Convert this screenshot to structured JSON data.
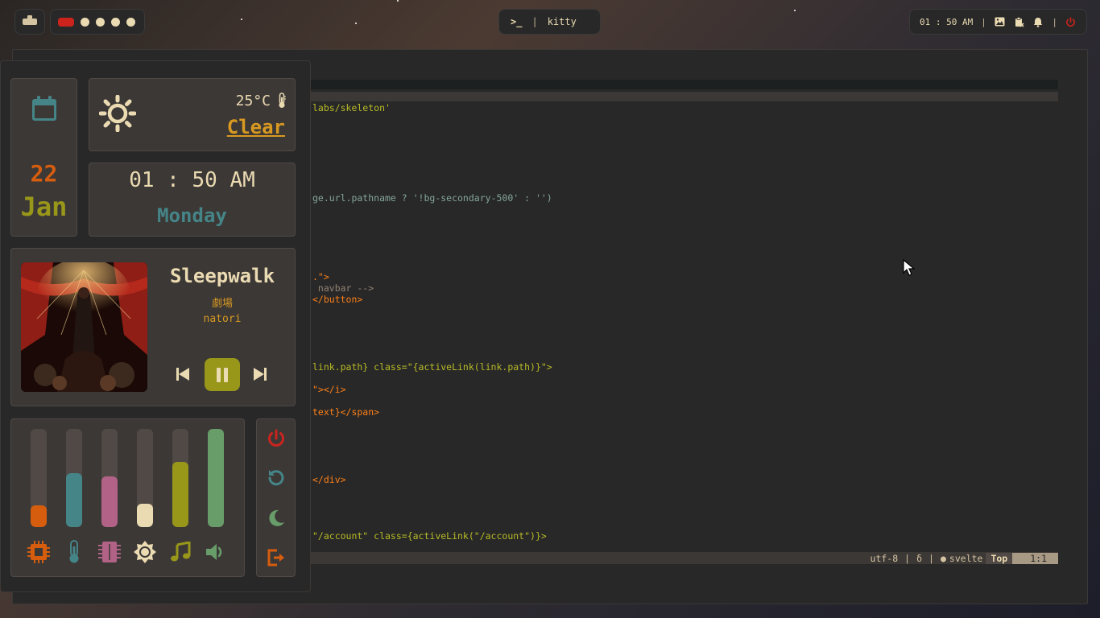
{
  "topbar": {
    "launcher_icon": "launcher-icon",
    "workspaces": [
      {
        "name": "workspace-1",
        "active": true
      },
      {
        "name": "workspace-2",
        "active": false
      },
      {
        "name": "workspace-3",
        "active": false
      },
      {
        "name": "workspace-4",
        "active": false
      },
      {
        "name": "workspace-5",
        "active": false
      }
    ],
    "window": {
      "icon": "terminal-icon",
      "prompt": ">_",
      "sep": "|",
      "title": "kitty"
    },
    "tray": {
      "time": "01 : 50 AM",
      "sep": "|",
      "icons": [
        "screenshot-icon",
        "clipboard-icon",
        "bell-icon",
        "power-icon"
      ]
    }
  },
  "editor": {
    "lines": [
      {
        "row": "l1",
        "text": "labs/skeleton'"
      },
      {
        "row": "l2",
        "text": "ge.url.pathname ? '!bg-secondary-500' : '')"
      },
      {
        "row": "l3",
        "text": ".\">"
      },
      {
        "row": "l4",
        "text": " navbar -->"
      },
      {
        "row": "l5",
        "text": "</button>"
      },
      {
        "row": "l6",
        "text": "link.path} class=\"{activeLink(link.path)}\">"
      },
      {
        "row": "l7",
        "text": "\"></i>"
      },
      {
        "row": "l8",
        "text": "text}</span>"
      },
      {
        "row": "l9",
        "text": "</div>"
      },
      {
        "row": "l10",
        "text": "\"/account\" class={activeLink(\"/account\")}>"
      }
    ],
    "status": {
      "encoding": "utf-8",
      "sep1": "|",
      "glyph": "δ",
      "sep2": "|",
      "dot": "●",
      "filetype": "svelte",
      "scroll": "Top",
      "position": "1:1"
    }
  },
  "dashboard": {
    "date": {
      "icon": "calendar-icon",
      "day": "22",
      "month": "Jan"
    },
    "weather": {
      "icon": "sun-icon",
      "temperature": "25°C",
      "temp_icon": "thermometer-icon",
      "condition": "Clear"
    },
    "clock": {
      "time": "01 : 50 AM",
      "weekday": "Monday"
    },
    "music": {
      "title": "Sleepwalk",
      "album": "劇場",
      "artist": "natori",
      "controls": [
        "previous-icon",
        "pause-icon",
        "next-icon"
      ]
    },
    "resources": [
      {
        "name": "cpu",
        "icon": "cpu-icon",
        "level": 0.22,
        "color": "#d65d0e"
      },
      {
        "name": "temperature",
        "icon": "thermometer-icon",
        "level": 0.55,
        "color": "#458588"
      },
      {
        "name": "memory",
        "icon": "memory-icon",
        "level": 0.52,
        "color": "#b16286"
      },
      {
        "name": "brightness",
        "icon": "brightness-icon",
        "level": 0.24,
        "color": "#ebdbb2"
      },
      {
        "name": "music-volume",
        "icon": "music-note-icon",
        "level": 0.66,
        "color": "#98971a"
      },
      {
        "name": "volume",
        "icon": "volume-icon",
        "level": 1.0,
        "color": "#689d6a"
      }
    ],
    "power": [
      {
        "name": "shutdown",
        "icon": "power-icon",
        "color": "#cc241d"
      },
      {
        "name": "reboot",
        "icon": "reboot-icon",
        "color": "#458588"
      },
      {
        "name": "sleep",
        "icon": "moon-icon",
        "color": "#689d6a"
      },
      {
        "name": "logout",
        "icon": "logout-icon",
        "color": "#d65d0e"
      }
    ]
  }
}
